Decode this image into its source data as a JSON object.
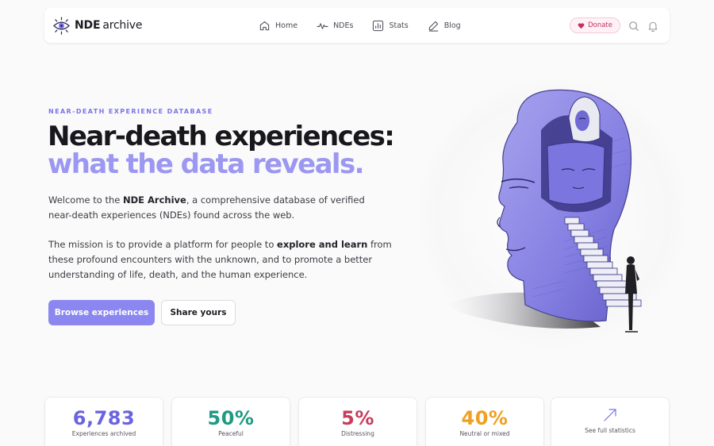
{
  "brand": {
    "name_strong": "NDE",
    "name_light": "archive"
  },
  "nav": {
    "links": [
      {
        "label": "Home",
        "icon": "home-icon"
      },
      {
        "label": "NDEs",
        "icon": "pulse-icon"
      },
      {
        "label": "Stats",
        "icon": "bar-chart-icon"
      },
      {
        "label": "Blog",
        "icon": "pen-icon"
      }
    ],
    "donate_label": "Donate"
  },
  "hero": {
    "eyebrow": "NEAR-DEATH EXPERIENCE DATABASE",
    "headline_line1": "Near-death experiences:",
    "headline_line2": "what the data reveals.",
    "intro_prefix": "Welcome to the ",
    "intro_bold": "NDE Archive",
    "intro_suffix": ", a comprehensive database of verified near-death experiences (NDEs) found across the web.",
    "mission_prefix": "The mission is to provide a platform for people to ",
    "mission_bold": "explore and learn",
    "mission_suffix": " from these profound encounters with the unknown, and to promote a better understanding of life, death, and the human experience.",
    "primary_button": "Browse experiences",
    "secondary_button": "Share yours"
  },
  "stats": [
    {
      "value": "6,783",
      "label": "Experiences archived",
      "color": "#6b64e0"
    },
    {
      "value": "50%",
      "label": "Peaceful",
      "color": "#1f9a83"
    },
    {
      "value": "5%",
      "label": "Distressing",
      "color": "#c73d5e"
    },
    {
      "value": "40%",
      "label": "Neutral or mixed",
      "color": "#f0a020"
    }
  ],
  "stats_link": {
    "label": "See full statistics"
  },
  "colors": {
    "accent": "#8c87f0",
    "headline_highlight": "#9c98f2",
    "donate": "#c22f63"
  }
}
